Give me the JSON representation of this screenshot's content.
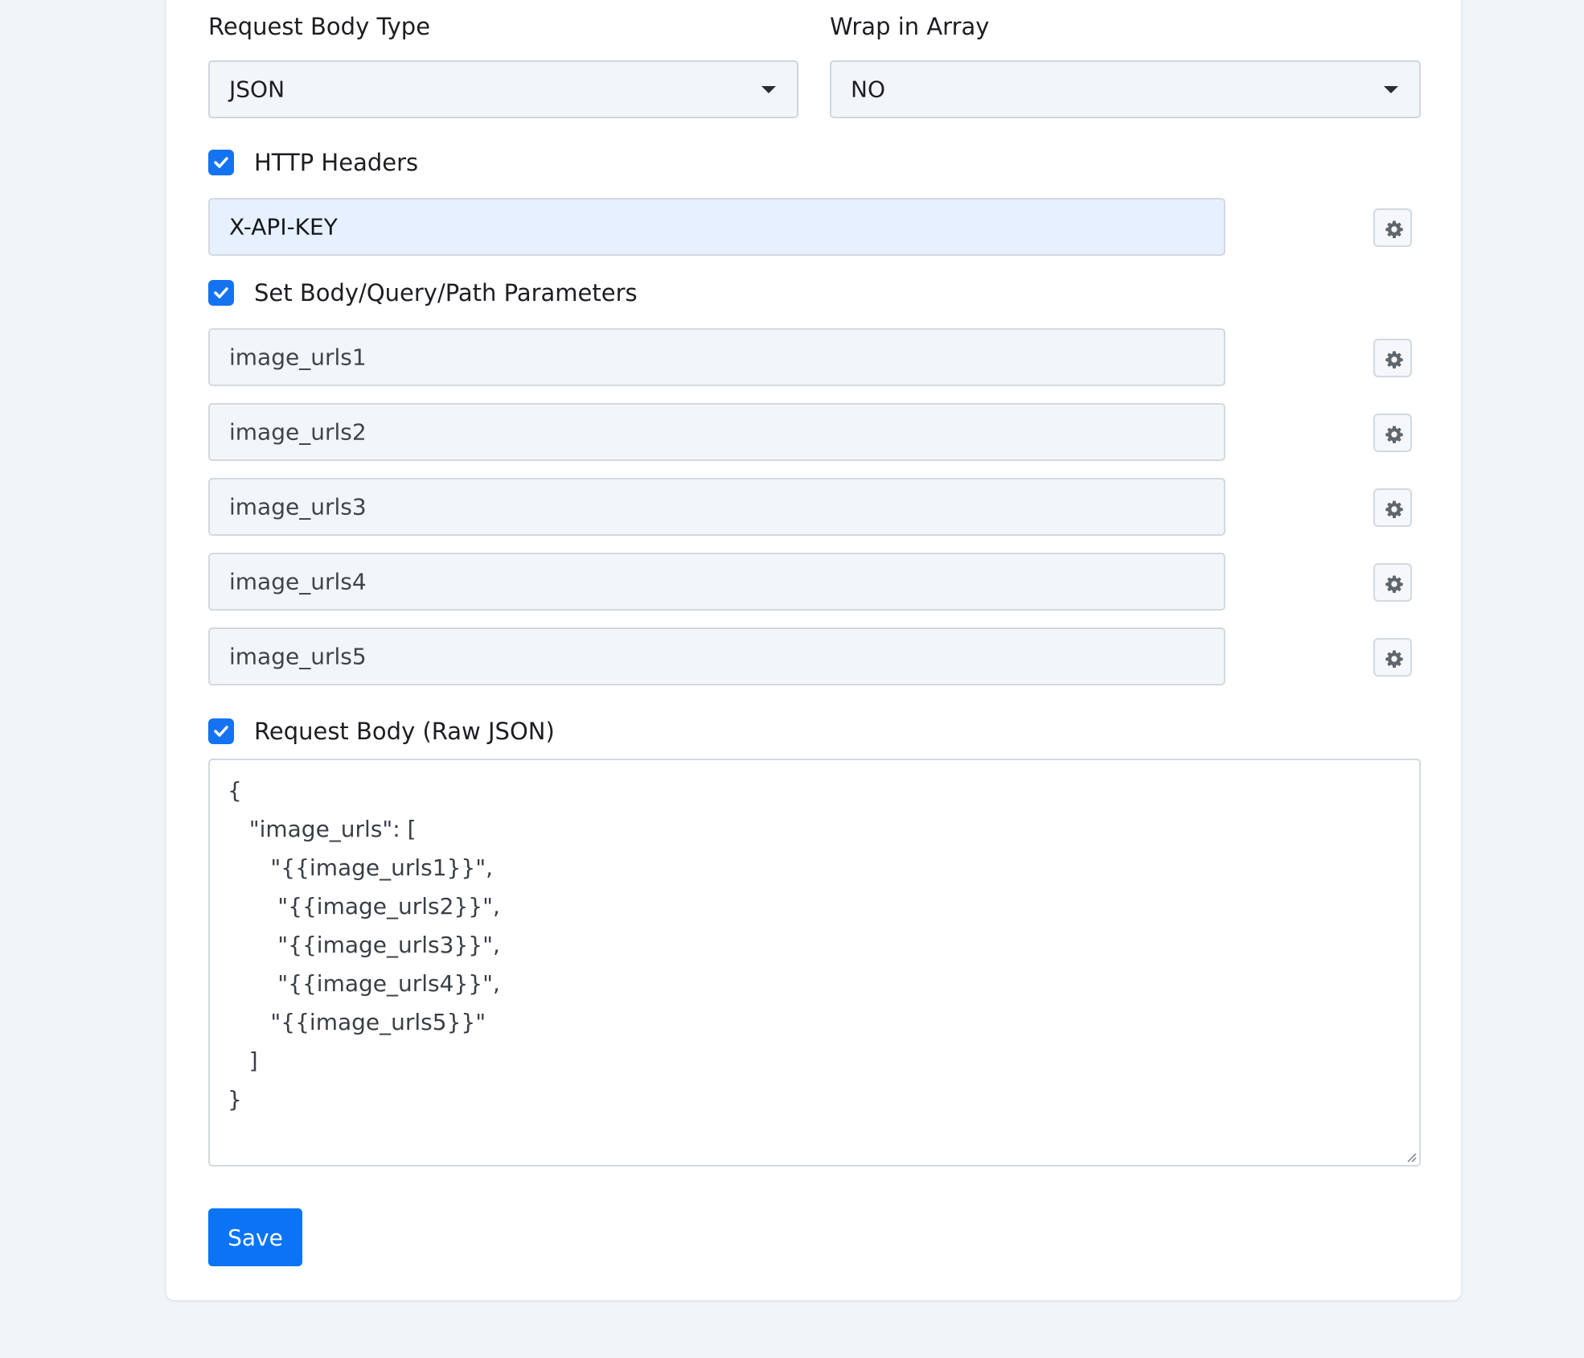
{
  "request_body_type": {
    "label": "Request Body Type",
    "value": "JSON"
  },
  "wrap_in_array": {
    "label": "Wrap in Array",
    "value": "NO"
  },
  "http_headers": {
    "label": "HTTP Headers",
    "checked": true,
    "items": [
      "X-API-KEY"
    ]
  },
  "parameters": {
    "label": "Set Body/Query/Path Parameters",
    "checked": true,
    "items": [
      "image_urls1",
      "image_urls2",
      "image_urls3",
      "image_urls4",
      "image_urls5"
    ]
  },
  "raw_json": {
    "label": "Request Body (Raw JSON)",
    "checked": true,
    "content": "{\n   \"image_urls\": [\n      \"{{image_urls1}}\",\n       \"{{image_urls2}}\",\n       \"{{image_urls3}}\",\n       \"{{image_urls4}}\",\n      \"{{image_urls5}}\"\n   ]\n}"
  },
  "save_label": "Save",
  "colors": {
    "accent": "#0a74f5",
    "checkbox": "#1473f1",
    "page_bg": "#f2f5f8",
    "field_bg": "#f3f6f9",
    "header_field_bg": "#e7f0fe"
  },
  "icons": {
    "checkbox": "check-icon",
    "settings": "gear-icon",
    "dropdown": "chevron-down-icon",
    "resize": "resize-handle-icon"
  }
}
